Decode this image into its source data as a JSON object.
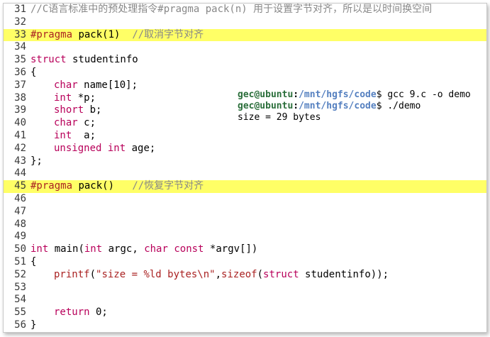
{
  "editor": {
    "lines": [
      {
        "n": "31",
        "highlight": false,
        "indent": false,
        "segs": [
          {
            "t": "//C语言标准中的预处理指令#pragma pack(n) 用于设置字节对齐，所以是以时间换空间",
            "c": "cm"
          }
        ]
      },
      {
        "n": "32",
        "highlight": false,
        "indent": false,
        "segs": []
      },
      {
        "n": "33",
        "highlight": true,
        "indent": false,
        "segs": [
          {
            "t": "#pragma",
            "c": "pp"
          },
          {
            "t": " pack(1)  ",
            "c": ""
          },
          {
            "t": "//取消字节对齐",
            "c": "cm"
          }
        ]
      },
      {
        "n": "34",
        "highlight": false,
        "indent": false,
        "segs": []
      },
      {
        "n": "35",
        "highlight": false,
        "indent": false,
        "segs": [
          {
            "t": "struct",
            "c": "kw"
          },
          {
            "t": " studentinfo",
            "c": ""
          }
        ]
      },
      {
        "n": "36",
        "highlight": false,
        "indent": false,
        "segs": [
          {
            "t": "{",
            "c": ""
          }
        ]
      },
      {
        "n": "37",
        "highlight": false,
        "indent": true,
        "segs": [
          {
            "t": "char",
            "c": "kw"
          },
          {
            "t": " name[10];",
            "c": ""
          }
        ]
      },
      {
        "n": "38",
        "highlight": false,
        "indent": true,
        "segs": [
          {
            "t": "int",
            "c": "kw"
          },
          {
            "t": " *p;",
            "c": ""
          }
        ]
      },
      {
        "n": "39",
        "highlight": false,
        "indent": true,
        "segs": [
          {
            "t": "short",
            "c": "kw"
          },
          {
            "t": " b;",
            "c": ""
          }
        ]
      },
      {
        "n": "40",
        "highlight": false,
        "indent": true,
        "segs": [
          {
            "t": "char",
            "c": "kw"
          },
          {
            "t": " c;",
            "c": ""
          }
        ]
      },
      {
        "n": "41",
        "highlight": false,
        "indent": true,
        "segs": [
          {
            "t": "int",
            "c": "kw"
          },
          {
            "t": "  a;",
            "c": ""
          }
        ]
      },
      {
        "n": "42",
        "highlight": false,
        "indent": true,
        "segs": [
          {
            "t": "unsigned",
            "c": "kw"
          },
          {
            "t": " ",
            "c": ""
          },
          {
            "t": "int",
            "c": "kw"
          },
          {
            "t": " age;",
            "c": ""
          }
        ]
      },
      {
        "n": "43",
        "highlight": false,
        "indent": false,
        "segs": [
          {
            "t": "};",
            "c": ""
          }
        ]
      },
      {
        "n": "44",
        "highlight": false,
        "indent": false,
        "segs": []
      },
      {
        "n": "45",
        "highlight": true,
        "indent": false,
        "segs": [
          {
            "t": "#pragma",
            "c": "pp"
          },
          {
            "t": " pack()   ",
            "c": ""
          },
          {
            "t": "//恢复字节对齐",
            "c": "cm"
          }
        ]
      },
      {
        "n": "46",
        "highlight": false,
        "indent": false,
        "segs": []
      },
      {
        "n": "47",
        "highlight": false,
        "indent": false,
        "segs": []
      },
      {
        "n": "48",
        "highlight": false,
        "indent": false,
        "segs": []
      },
      {
        "n": "49",
        "highlight": false,
        "indent": false,
        "segs": []
      },
      {
        "n": "50",
        "highlight": false,
        "indent": false,
        "segs": [
          {
            "t": "int",
            "c": "kw"
          },
          {
            "t": " main(",
            "c": ""
          },
          {
            "t": "int",
            "c": "kw"
          },
          {
            "t": " argc, ",
            "c": ""
          },
          {
            "t": "char",
            "c": "kw"
          },
          {
            "t": " ",
            "c": ""
          },
          {
            "t": "const",
            "c": "kw"
          },
          {
            "t": " *argv[])",
            "c": ""
          }
        ]
      },
      {
        "n": "51",
        "highlight": false,
        "indent": false,
        "segs": [
          {
            "t": "{",
            "c": ""
          }
        ]
      },
      {
        "n": "52",
        "highlight": false,
        "indent": true,
        "segs": [
          {
            "t": "printf",
            "c": "fn"
          },
          {
            "t": "(",
            "c": ""
          },
          {
            "t": "\"size = %ld bytes\\n\"",
            "c": "st"
          },
          {
            "t": ",",
            "c": ""
          },
          {
            "t": "sizeof",
            "c": "fn"
          },
          {
            "t": "(",
            "c": ""
          },
          {
            "t": "struct",
            "c": "kw"
          },
          {
            "t": " studentinfo));",
            "c": ""
          }
        ]
      },
      {
        "n": "53",
        "highlight": false,
        "indent": false,
        "segs": []
      },
      {
        "n": "54",
        "highlight": false,
        "indent": false,
        "segs": []
      },
      {
        "n": "55",
        "highlight": false,
        "indent": true,
        "segs": [
          {
            "t": "return",
            "c": "kw"
          },
          {
            "t": " 0;",
            "c": ""
          }
        ]
      },
      {
        "n": "56",
        "highlight": false,
        "indent": false,
        "segs": [
          {
            "t": "}",
            "c": ""
          }
        ]
      }
    ]
  },
  "terminal": {
    "rows": [
      {
        "user": "gec@ubuntu",
        "sep": ":",
        "path": "/mnt/hgfs/code",
        "cmd": "$ gcc 9.c -o demo"
      },
      {
        "user": "gec@ubuntu",
        "sep": ":",
        "path": "/mnt/hgfs/code",
        "cmd": "$ ./demo"
      },
      {
        "user": "",
        "sep": "",
        "path": "",
        "cmd": "size = 29 bytes"
      }
    ]
  },
  "colors": {
    "highlight": "#ffff66",
    "keyword": "#b8005a",
    "comment": "#888888",
    "string": "#aa2222",
    "prompt_user": "#2a6e3a",
    "prompt_path": "#5580c0"
  }
}
